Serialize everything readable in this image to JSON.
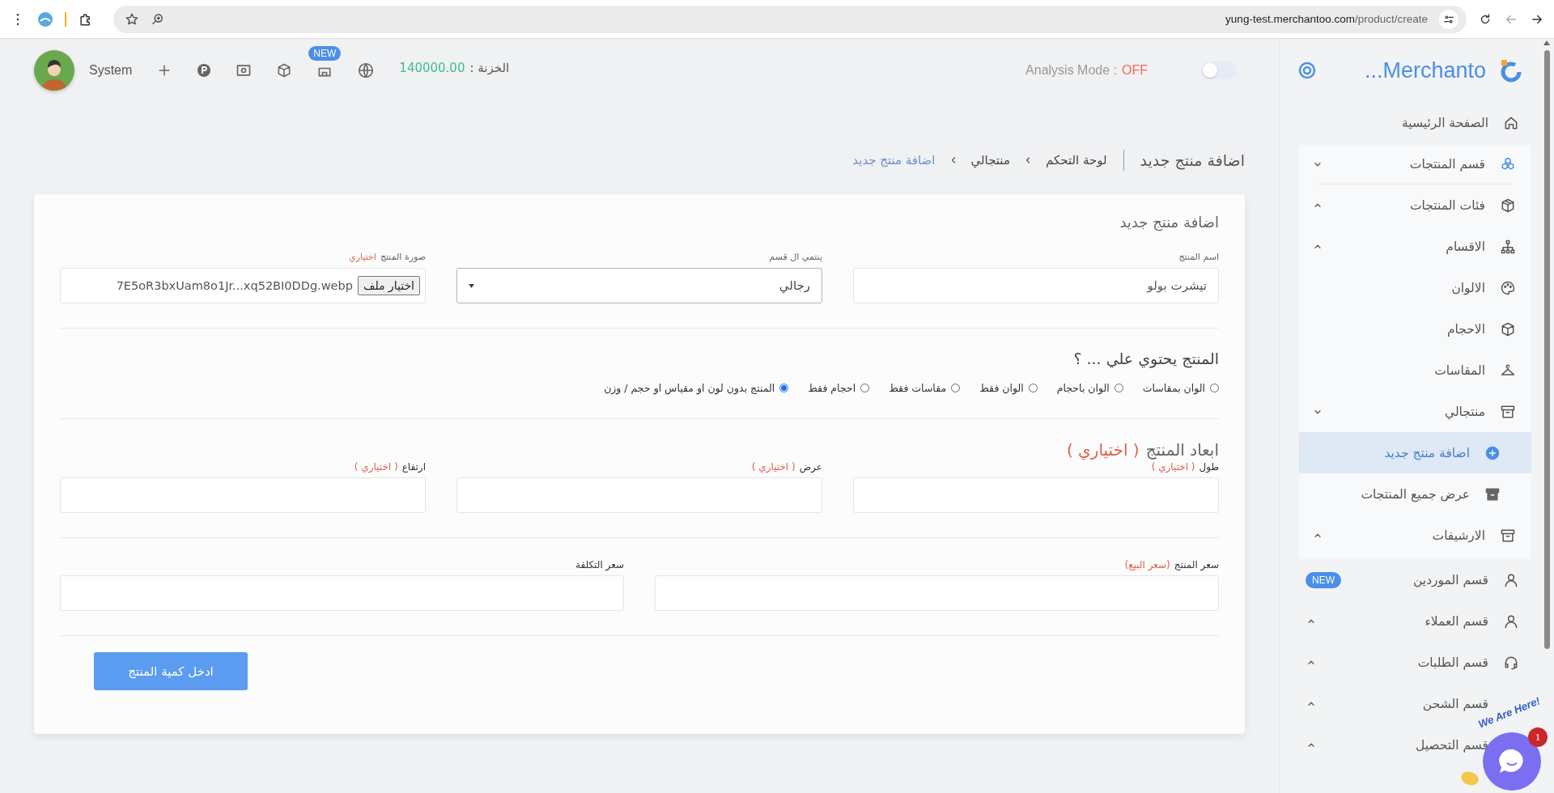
{
  "browser": {
    "url_host": "yung-test.merchantoo.com",
    "url_path": "/product/create"
  },
  "header": {
    "user": "System",
    "new_badge": "NEW",
    "treasury_label": "الخزنة :",
    "treasury_value": "140000.00",
    "analysis_label": "Analysis Mode :",
    "analysis_value": "OFF",
    "analysis_on": false
  },
  "brand": {
    "name": "...Merchanto"
  },
  "sidebar": {
    "items": [
      {
        "label": "الصفحة الرئيسية",
        "selected": false
      },
      {
        "label": "قسم المنتجات",
        "selected": false,
        "expanded": true,
        "children": [
          {
            "label": "فئات المنتجات",
            "selected": false,
            "expanded": false
          },
          {
            "label": "الاقسام",
            "selected": false,
            "expanded": false
          },
          {
            "label": "الالوان",
            "selected": false
          },
          {
            "label": "الاحجام",
            "selected": false
          },
          {
            "label": "المقاسات",
            "selected": false
          },
          {
            "label": "منتجالي",
            "selected": false,
            "expanded": true,
            "children": [
              {
                "label": "اضافة منتج جديد",
                "selected": true
              },
              {
                "label": "عرض جميع المنتجات",
                "selected": false
              }
            ]
          },
          {
            "label": "الارشيفات",
            "selected": false,
            "expanded": false
          }
        ]
      },
      {
        "label": "قسم الموردين",
        "selected": false,
        "badge": "NEW"
      },
      {
        "label": "قسم العملاء",
        "selected": false,
        "expanded": false
      },
      {
        "label": "قسم الطلبات",
        "selected": false,
        "expanded": false
      },
      {
        "label": "قسم الشحن",
        "selected": false,
        "expanded": false
      },
      {
        "label": "قسم التحصيل",
        "selected": false,
        "expanded": false
      }
    ]
  },
  "page": {
    "title": "اضافة منتج جديد",
    "breadcrumbs": [
      {
        "label": "لوحة التحكم",
        "selected": false
      },
      {
        "label": "منتجالي",
        "selected": false
      },
      {
        "label": "اضافة منتج جديد",
        "selected": true
      }
    ]
  },
  "form": {
    "title": "اضافة منتج جديد",
    "fields": [
      {
        "kind": "text",
        "label": "اسم المنتج",
        "value": "تيشرت بولو"
      },
      {
        "kind": "select",
        "label": "ينتمي ال قسم",
        "value": "رجالي"
      },
      {
        "kind": "file",
        "label": "صورة المنتج",
        "note": "اختياري",
        "button": "اختيار ملف",
        "value": "7E5oR3bxUam8o1Jr...xq52BI0DDg.webp"
      }
    ],
    "contains": {
      "title": "المنتج يحتوي علي ... ؟",
      "options": [
        {
          "label": "الوان بمقاسات",
          "selected": false
        },
        {
          "label": "الوان باحجام",
          "selected": false
        },
        {
          "label": "الوان فقط",
          "selected": false
        },
        {
          "label": "مقاسات فقط",
          "selected": false
        },
        {
          "label": "احجام فقط",
          "selected": false
        },
        {
          "label": "المنتج بدون لون او مقياس او حجم / وزن",
          "selected": true
        }
      ]
    },
    "dimensions": {
      "title": "ابعاد المنتج",
      "note": "( اختياري )",
      "fields": [
        {
          "label": "طول",
          "note": "( اختياري )"
        },
        {
          "label": "عرض",
          "note": "( اختياري )"
        },
        {
          "label": "ارتفاع",
          "note": "( اختياري )"
        }
      ]
    },
    "prices": [
      {
        "label": "سعر المنتج",
        "note": "(سعر البيع)"
      },
      {
        "label": "سعر التكلفة"
      }
    ],
    "submit": "ادخل كمية المنتج"
  },
  "chat": {
    "greeting": "We Are Here!",
    "unread": "1"
  }
}
